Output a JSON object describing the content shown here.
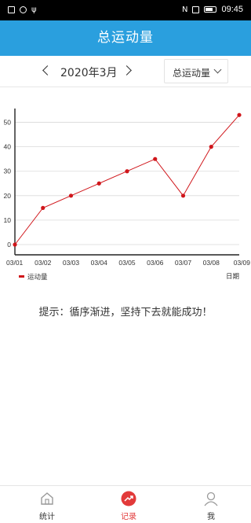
{
  "status_bar": {
    "time": "09:45"
  },
  "app_bar": {
    "title": "总运动量"
  },
  "date_nav": {
    "month": "2020年3月",
    "select_value": "总运动量"
  },
  "chart_data": {
    "type": "line",
    "categories": [
      "03/01",
      "03/02",
      "03/03",
      "03/04",
      "03/05",
      "03/06",
      "03/07",
      "03/08",
      "03/09"
    ],
    "series": [
      {
        "name": "运动量",
        "values": [
          0,
          15,
          20,
          25,
          30,
          35,
          20,
          40,
          53
        ],
        "color": "#d0161b"
      }
    ],
    "yticks": [
      0,
      10,
      20,
      30,
      40,
      50
    ],
    "ylim": [
      0,
      55
    ],
    "xlabel": "日期",
    "ylabel": "",
    "grid": true,
    "legend": "bottom-left"
  },
  "tip": "提示：循序渐进，坚持下去就能成功！",
  "tabs": [
    {
      "label": "统计",
      "icon": "home-icon",
      "active": false
    },
    {
      "label": "记录",
      "icon": "trend-icon",
      "active": true
    },
    {
      "label": "我",
      "icon": "user-icon",
      "active": false
    }
  ],
  "colors": {
    "primary": "#2a9fde",
    "accent": "#e23a3a",
    "line": "#d0161b"
  }
}
